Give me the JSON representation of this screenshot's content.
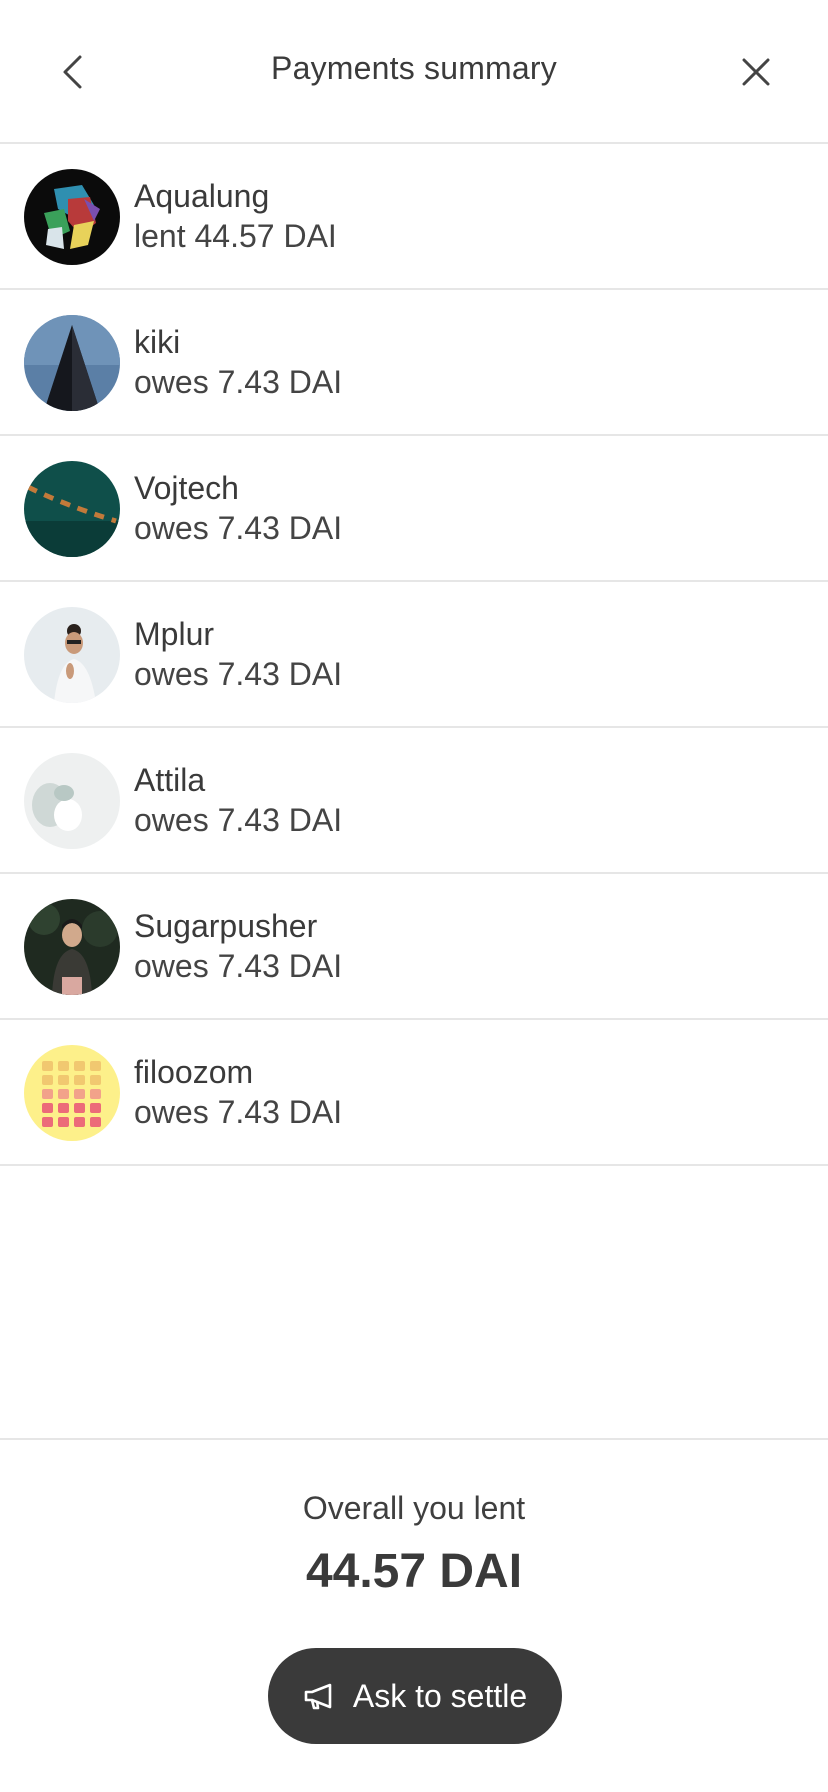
{
  "header": {
    "title": "Payments summary",
    "back_icon": "chevron-left-icon",
    "close_icon": "close-icon"
  },
  "members": [
    {
      "name": "Aqualung",
      "status": "lent 44.57 DAI"
    },
    {
      "name": "kiki",
      "status": "owes 7.43 DAI"
    },
    {
      "name": "Vojtech",
      "status": "owes 7.43 DAI"
    },
    {
      "name": "Mplur",
      "status": "owes 7.43 DAI"
    },
    {
      "name": "Attila",
      "status": "owes 7.43 DAI"
    },
    {
      "name": "Sugarpusher",
      "status": "owes 7.43 DAI"
    },
    {
      "name": "filoozom",
      "status": "owes 7.43 DAI"
    }
  ],
  "summary": {
    "label": "Overall you lent",
    "amount": "44.57 DAI"
  },
  "settle_button": {
    "label": "Ask to settle",
    "icon": "megaphone-icon"
  },
  "colors": {
    "text": "#3a3a3a",
    "divider": "#e6e6e6",
    "button_bg": "#3a3a3a",
    "button_text": "#ffffff"
  }
}
